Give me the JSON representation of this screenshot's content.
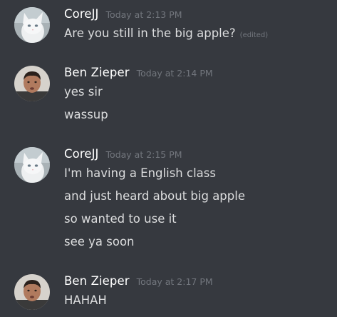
{
  "messages": [
    {
      "username": "CoreJJ",
      "timestamp": "Today at 2:13 PM",
      "avatar": "white-cat-avatar",
      "lines": [
        "Are you still in the big apple?"
      ],
      "edited_label": "(edited)"
    },
    {
      "username": "Ben Zieper",
      "timestamp": "Today at 2:14 PM",
      "avatar": "person-avatar",
      "lines": [
        "yes sir",
        "wassup"
      ]
    },
    {
      "username": "CoreJJ",
      "timestamp": "Today at 2:15 PM",
      "avatar": "white-cat-avatar",
      "lines": [
        "I'm having a English class",
        "and just heard about big apple",
        "so wanted to use it",
        "see ya soon"
      ]
    },
    {
      "username": "Ben Zieper",
      "timestamp": "Today at 2:17 PM",
      "avatar": "person-avatar",
      "lines": [
        "HAHAH"
      ]
    }
  ],
  "colors": {
    "background": "#36393f",
    "username": "#ffffff",
    "message_text": "#dcddde",
    "timestamp": "#72767d"
  }
}
